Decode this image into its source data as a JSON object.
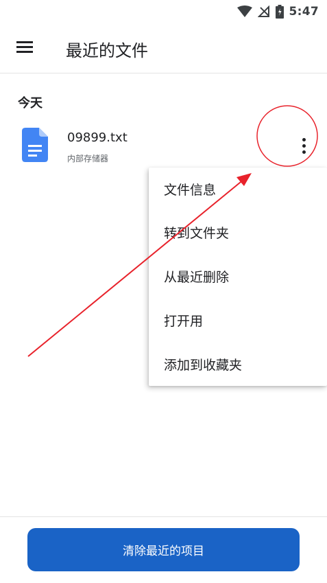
{
  "status_bar": {
    "time": "5:47",
    "icons": [
      "wifi-icon",
      "no-sim-icon",
      "battery-icon"
    ]
  },
  "app_bar": {
    "title": "最近的文件",
    "menu_icon": "hamburger-menu-icon"
  },
  "section": {
    "header": "今天"
  },
  "file": {
    "name": "09899.txt",
    "location": "内部存储器",
    "icon": "document-file-icon",
    "icon_color": "#4285f4"
  },
  "context_menu": {
    "items": [
      {
        "label": "文件信息"
      },
      {
        "label": "转到文件夹"
      },
      {
        "label": "从最近删除"
      },
      {
        "label": "打开用"
      },
      {
        "label": "添加到收藏夹"
      }
    ]
  },
  "annotation": {
    "color": "#e8222b"
  },
  "bottom": {
    "clear_label": "清除最近的项目",
    "accent": "#1a63c6"
  }
}
